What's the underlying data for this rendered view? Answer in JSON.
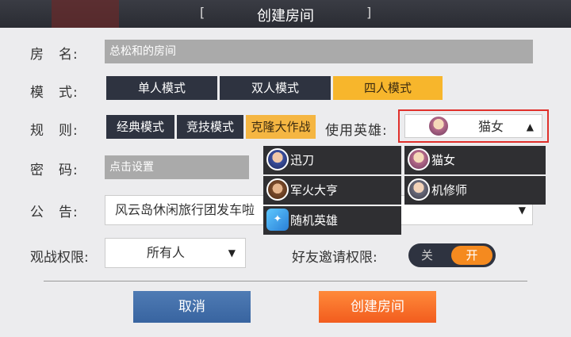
{
  "header": {
    "title": "创建房间",
    "bracket_left": "[",
    "bracket_right": "]"
  },
  "form": {
    "room_name_label": "房　名:",
    "room_name_value": "总松和的房间",
    "mode_label": "模　式:",
    "modes": [
      "单人模式",
      "双人模式",
      "四人模式"
    ],
    "mode_selected": "四人模式",
    "rule_label": "规　则:",
    "rules": [
      "经典模式",
      "竞技模式",
      "克隆大作战"
    ],
    "rule_selected": "克隆大作战",
    "hero_label": "使用英雄:",
    "hero_selected": "猫女",
    "password_label": "密　码:",
    "password_placeholder": "点击设置",
    "notice_label": "公　告:",
    "notice_value": "风云岛休闲旅行团发车啦",
    "spectate_label": "观战权限:",
    "spectate_value": "所有人",
    "friend_invite_label": "好友邀请权限:",
    "toggle_off": "关",
    "toggle_on": "开"
  },
  "hero_dropdown": {
    "items": [
      {
        "name": "迅刀",
        "icon": "hero-xundao-icon"
      },
      {
        "name": "猫女",
        "icon": "hero-maonv-icon"
      },
      {
        "name": "军火大亨",
        "icon": "hero-junhuo-icon"
      },
      {
        "name": "机修师",
        "icon": "hero-jixiu-icon"
      },
      {
        "name": "随机英雄",
        "icon": "random-hero-icon"
      }
    ]
  },
  "buttons": {
    "cancel": "取消",
    "create": "创建房间"
  },
  "colors": {
    "accent": "#f7b62c",
    "dark": "#2e3340",
    "create": "#f25c1e",
    "cancel": "#3864a0",
    "highlight": "#e0302b"
  }
}
